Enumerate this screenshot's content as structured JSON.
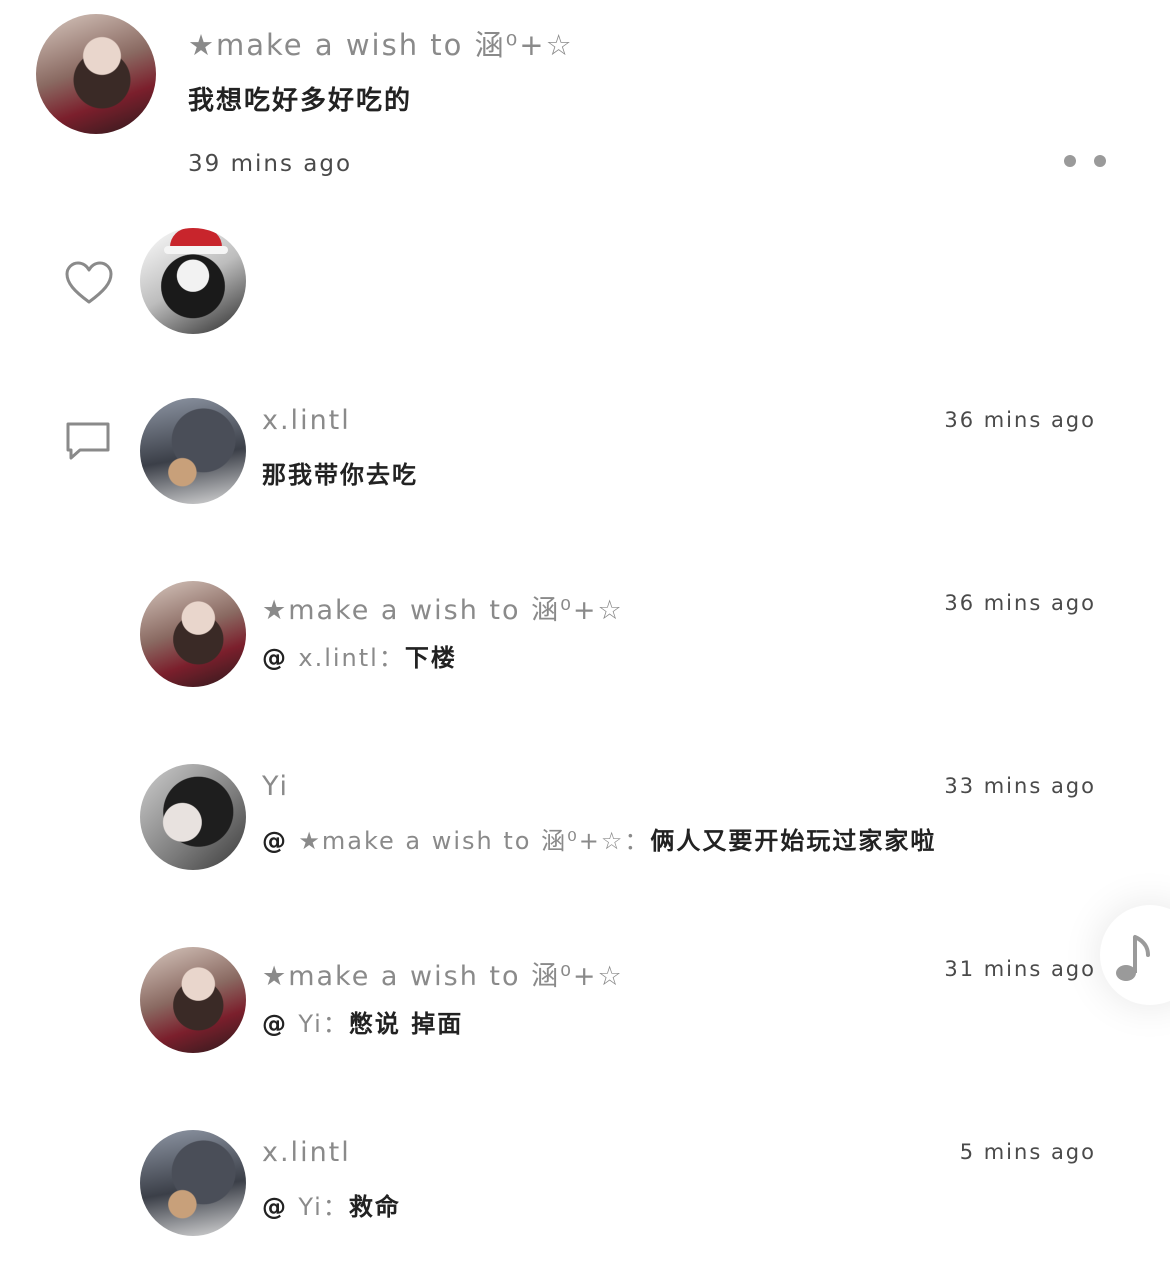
{
  "post": {
    "author": "★make a wish to 涵⁰+☆",
    "text": "我想吃好多好吃的",
    "time": "39 mins ago",
    "more_icon": "more-dots-icon"
  },
  "likes": {
    "icon": "heart-icon"
  },
  "comments_icon": "comment-icon",
  "comments": [
    {
      "author": "x.lintl",
      "time": "36 mins ago",
      "text": "那我带你去吃",
      "mention": "",
      "target": ""
    },
    {
      "author": "★make a wish to 涵⁰+☆",
      "time": "36 mins ago",
      "mention": "@",
      "target": "x.lintl：",
      "text": "下楼"
    },
    {
      "author": "Yi",
      "time": "33 mins ago",
      "mention": "@",
      "target": "★make a wish to 涵⁰+☆：",
      "text": "俩人又要开始玩过家家啦"
    },
    {
      "author": "★make a wish to 涵⁰+☆",
      "time": "31 mins ago",
      "mention": "@",
      "target": "Yi：",
      "text": "憋说 掉面"
    },
    {
      "author": "x.lintl",
      "time": "5 mins ago",
      "mention": "@",
      "target": "Yi：",
      "text": "救命"
    }
  ],
  "floating": {
    "icon": "music-note-icon"
  }
}
